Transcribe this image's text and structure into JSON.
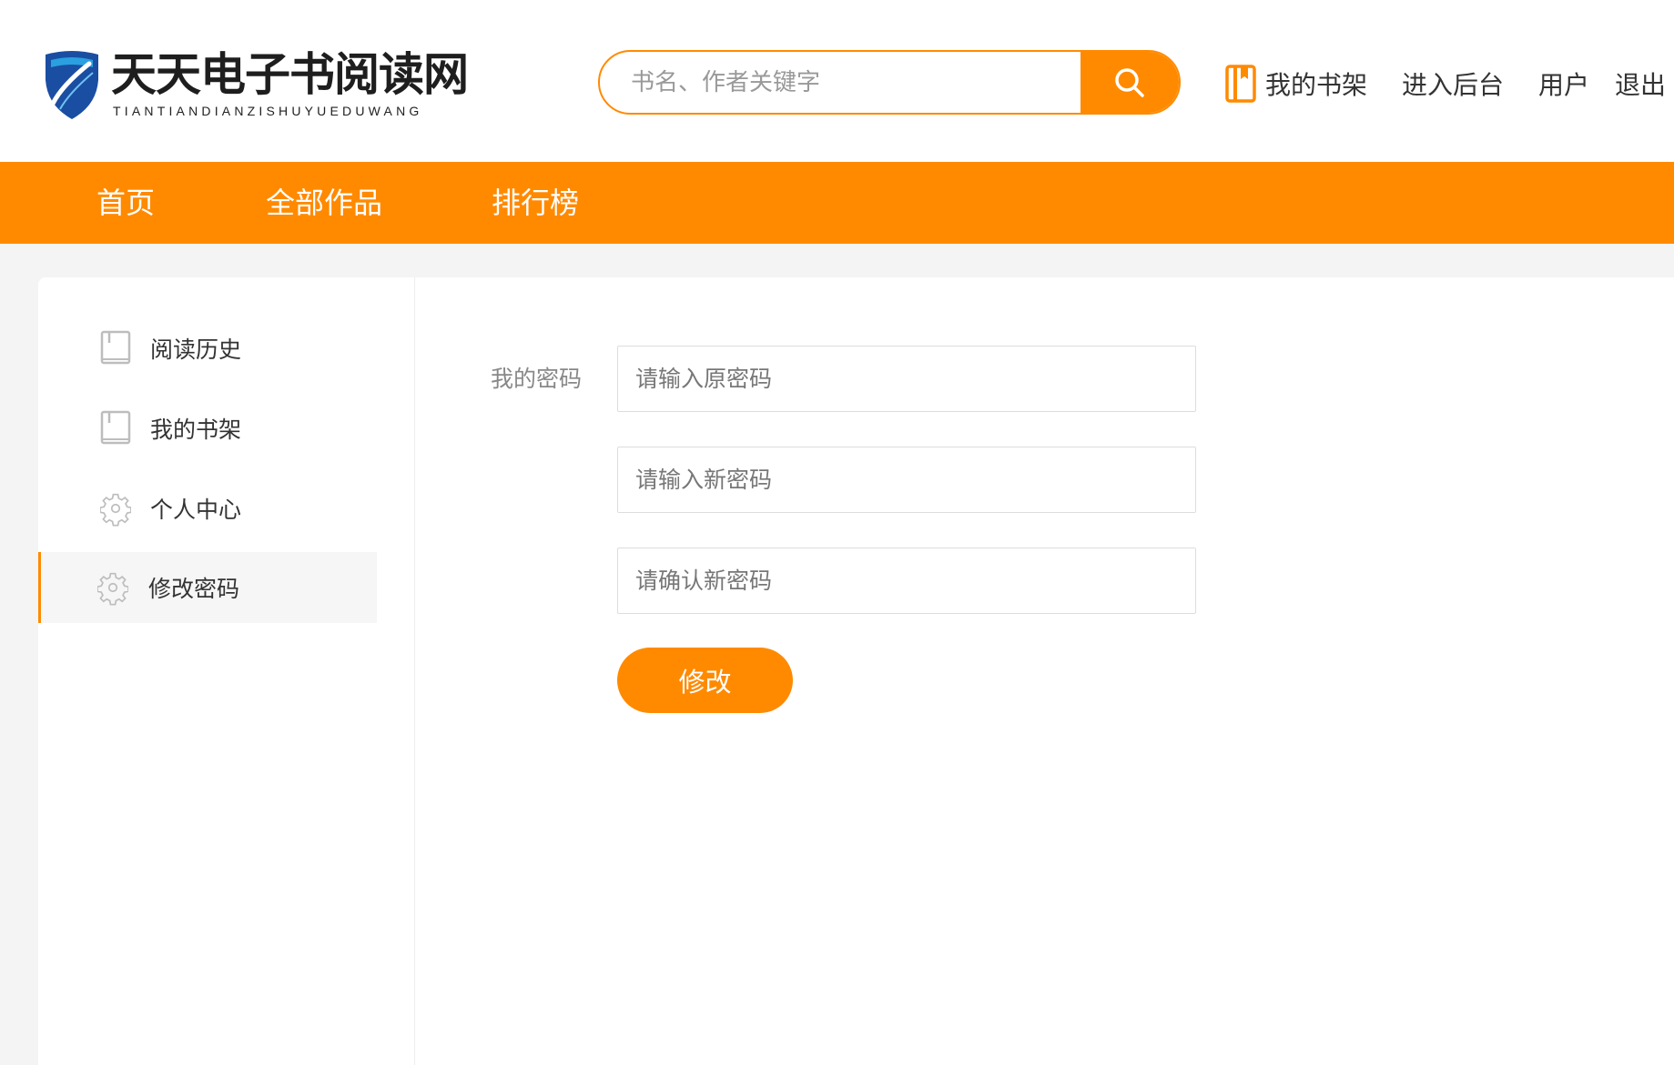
{
  "brand": {
    "title": "天天电子书阅读网",
    "subtitle": "TIANTIANDIANZISHUYUEDUWANG"
  },
  "search": {
    "placeholder": "书名、作者关键字"
  },
  "toplinks": {
    "shelf": "我的书架",
    "admin": "进入后台",
    "user": "用户",
    "logout": "退出"
  },
  "nav": {
    "items": [
      {
        "label": "首页"
      },
      {
        "label": "全部作品"
      },
      {
        "label": "排行榜"
      }
    ]
  },
  "sidebar": {
    "items": [
      {
        "label": "阅读历史",
        "icon": "book-icon"
      },
      {
        "label": "我的书架",
        "icon": "book-icon"
      },
      {
        "label": "个人中心",
        "icon": "gear-icon"
      },
      {
        "label": "修改密码",
        "icon": "gear-icon",
        "active": true
      }
    ]
  },
  "form": {
    "label": "我的密码",
    "old_placeholder": "请输入原密码",
    "new_placeholder": "请输入新密码",
    "confirm_placeholder": "请确认新密码",
    "submit": "修改"
  },
  "colors": {
    "accent": "#ff8a00",
    "brand_blue": "#1a4ea2"
  }
}
